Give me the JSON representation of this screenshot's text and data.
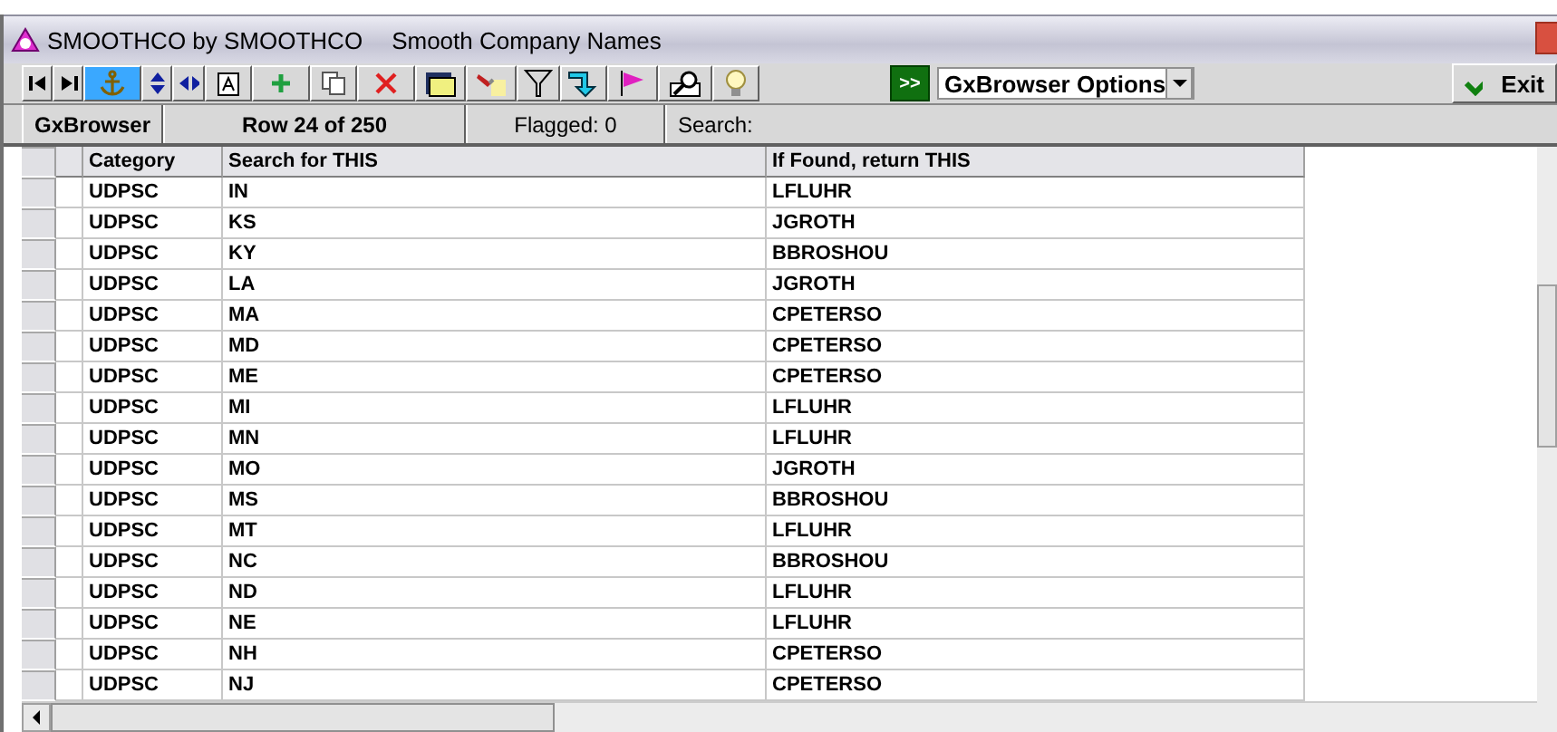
{
  "window": {
    "title": "SMOOTHCO by SMOOTHCO",
    "subtitle": "Smooth Company Names"
  },
  "toolbar": {
    "tools": [
      {
        "kind": "first",
        "selected": false
      },
      {
        "kind": "last",
        "selected": false
      },
      {
        "kind": "anchor",
        "selected": true
      },
      {
        "kind": "updown",
        "selected": false
      },
      {
        "kind": "leftright",
        "selected": false
      },
      {
        "kind": "textbox",
        "selected": false
      },
      {
        "kind": "add",
        "selected": false
      },
      {
        "kind": "copy",
        "selected": false
      },
      {
        "kind": "delete",
        "selected": false
      },
      {
        "kind": "folder",
        "selected": false
      },
      {
        "kind": "flashlight",
        "selected": false
      },
      {
        "kind": "filter",
        "selected": false
      },
      {
        "kind": "jump",
        "selected": false
      },
      {
        "kind": "flag",
        "selected": false
      },
      {
        "kind": "find",
        "selected": false
      },
      {
        "kind": "bulb",
        "selected": false
      }
    ],
    "go_label": ">>",
    "options": "GxBrowser Options",
    "exit": "Exit"
  },
  "status": {
    "name": "GxBrowser",
    "row": "Row 24 of 250",
    "flagged": "Flagged: 0",
    "search": "Search:"
  },
  "table": {
    "columns": [
      "Category",
      "Search for THIS",
      "If Found, return THIS"
    ],
    "rows": [
      [
        "UDPSC",
        "IN",
        "LFLUHR"
      ],
      [
        "UDPSC",
        "KS",
        "JGROTH"
      ],
      [
        "UDPSC",
        "KY",
        "BBROSHOU"
      ],
      [
        "UDPSC",
        "LA",
        "JGROTH"
      ],
      [
        "UDPSC",
        "MA",
        "CPETERSO"
      ],
      [
        "UDPSC",
        "MD",
        "CPETERSO"
      ],
      [
        "UDPSC",
        "ME",
        "CPETERSO"
      ],
      [
        "UDPSC",
        "MI",
        "LFLUHR"
      ],
      [
        "UDPSC",
        "MN",
        "LFLUHR"
      ],
      [
        "UDPSC",
        "MO",
        "JGROTH"
      ],
      [
        "UDPSC",
        "MS",
        "BBROSHOU"
      ],
      [
        "UDPSC",
        "MT",
        "LFLUHR"
      ],
      [
        "UDPSC",
        "NC",
        "BBROSHOU"
      ],
      [
        "UDPSC",
        "ND",
        "LFLUHR"
      ],
      [
        "UDPSC",
        "NE",
        "LFLUHR"
      ],
      [
        "UDPSC",
        "NH",
        "CPETERSO"
      ],
      [
        "UDPSC",
        "NJ",
        "CPETERSO"
      ]
    ]
  }
}
